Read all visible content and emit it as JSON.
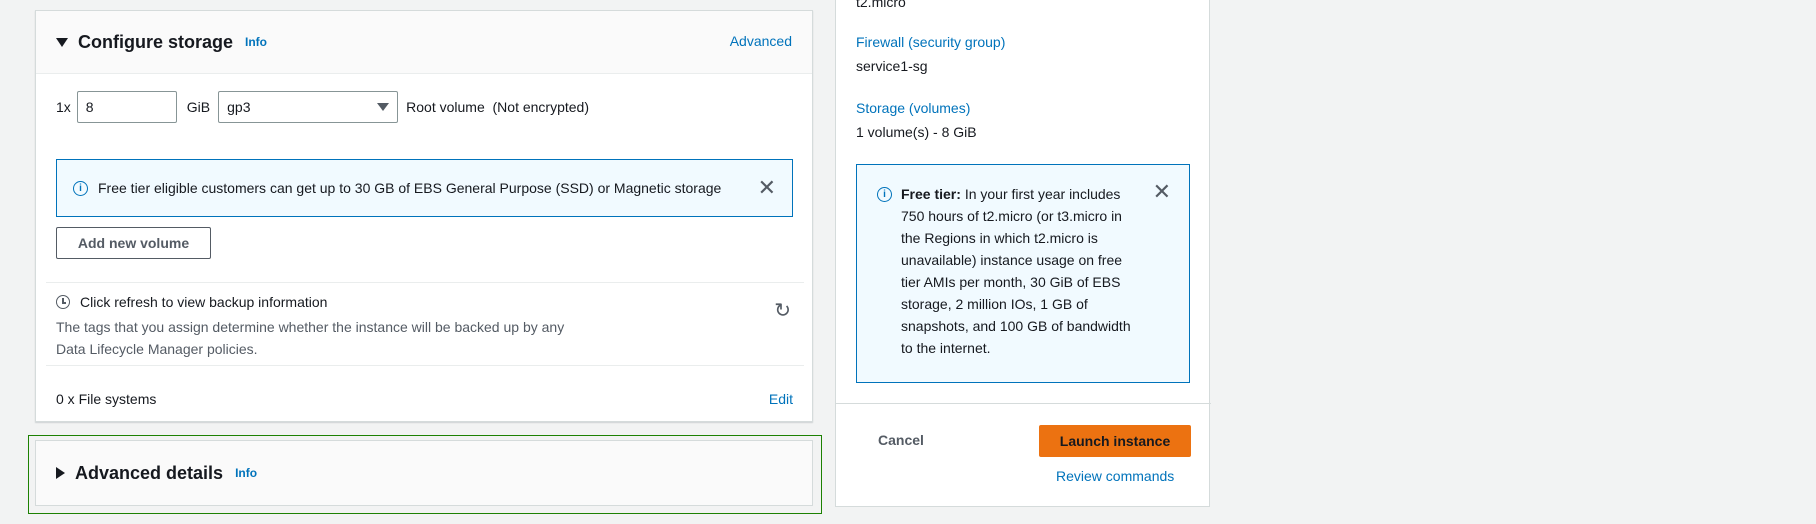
{
  "storage": {
    "title": "Configure storage",
    "info": "Info",
    "advanced": "Advanced",
    "volume": {
      "multiplier": "1x",
      "size": "8",
      "unit": "GiB",
      "type": "gp3",
      "root_label": "Root volume  (Not encrypted)"
    },
    "alert": "Free tier eligible customers can get up to 30 GB of EBS General Purpose (SSD) or Magnetic storage",
    "add_volume": "Add new volume",
    "backup": {
      "title": "Click refresh to view backup information",
      "description": "The tags that you assign determine whether the instance will be backed up by any Data Lifecycle Manager policies."
    },
    "file_systems": "0 x File systems",
    "edit": "Edit"
  },
  "advanced_details": {
    "title": "Advanced details",
    "info": "Info"
  },
  "summary": {
    "instance_type": "t2.micro",
    "firewall_label": "Firewall (security group)",
    "firewall_value": "service1-sg",
    "storage_label": "Storage (volumes)",
    "storage_value": "1 volume(s) - 8 GiB",
    "free_tier_title": "Free tier:",
    "free_tier_text": "In your first year includes 750 hours of t2.micro (or t3.micro in the Regions in which t2.micro is unavailable) instance usage on free tier AMIs per month, 30 GiB of EBS storage, 2 million IOs, 1 GB of snapshots, and 100 GB of bandwidth to the internet.",
    "cancel": "Cancel",
    "launch": "Launch instance",
    "review": "Review commands"
  },
  "colors": {
    "link": "#0073bb",
    "primary_button": "#ec7211",
    "focus_outline": "#1d8102"
  }
}
